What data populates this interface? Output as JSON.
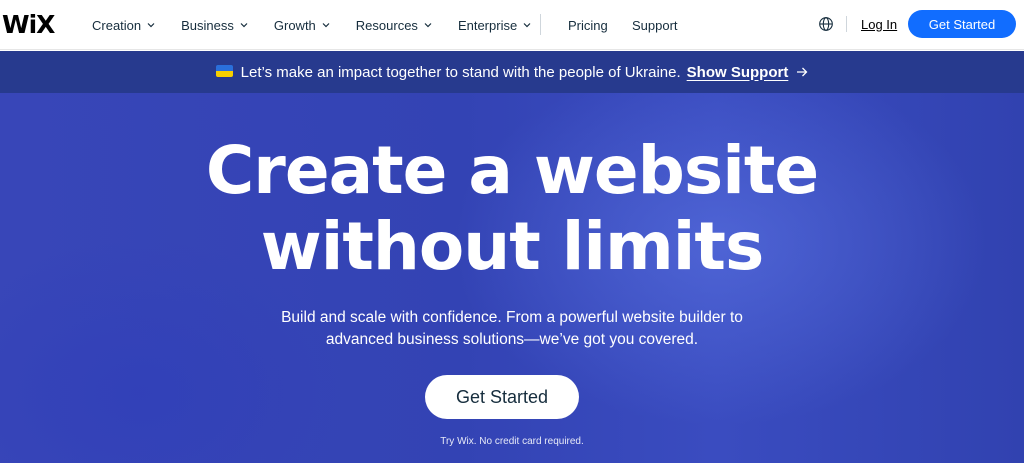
{
  "nav": {
    "logo": "WiX",
    "items": [
      {
        "label": "Creation"
      },
      {
        "label": "Business"
      },
      {
        "label": "Growth"
      },
      {
        "label": "Resources"
      },
      {
        "label": "Enterprise"
      }
    ],
    "pricing": "Pricing",
    "support": "Support",
    "login": "Log In",
    "cta": "Get Started",
    "cta_color": "#116dff"
  },
  "banner": {
    "text": "Let’s make an impact together to stand with the people of Ukraine.",
    "link": "Show Support",
    "background": "#273a8e"
  },
  "hero": {
    "title_line1": "Create a website",
    "title_line2": "without limits",
    "subtitle_line1": "Build and scale with confidence. From a powerful website builder to",
    "subtitle_line2": "advanced business solutions—we’ve got you covered.",
    "cta": "Get Started",
    "note": "Try Wix. No credit card required."
  },
  "icons": {
    "chevron": "chevron-down-icon",
    "globe": "globe-icon",
    "arrow": "arrow-right-icon",
    "flag": "ukraine-flag-icon"
  }
}
